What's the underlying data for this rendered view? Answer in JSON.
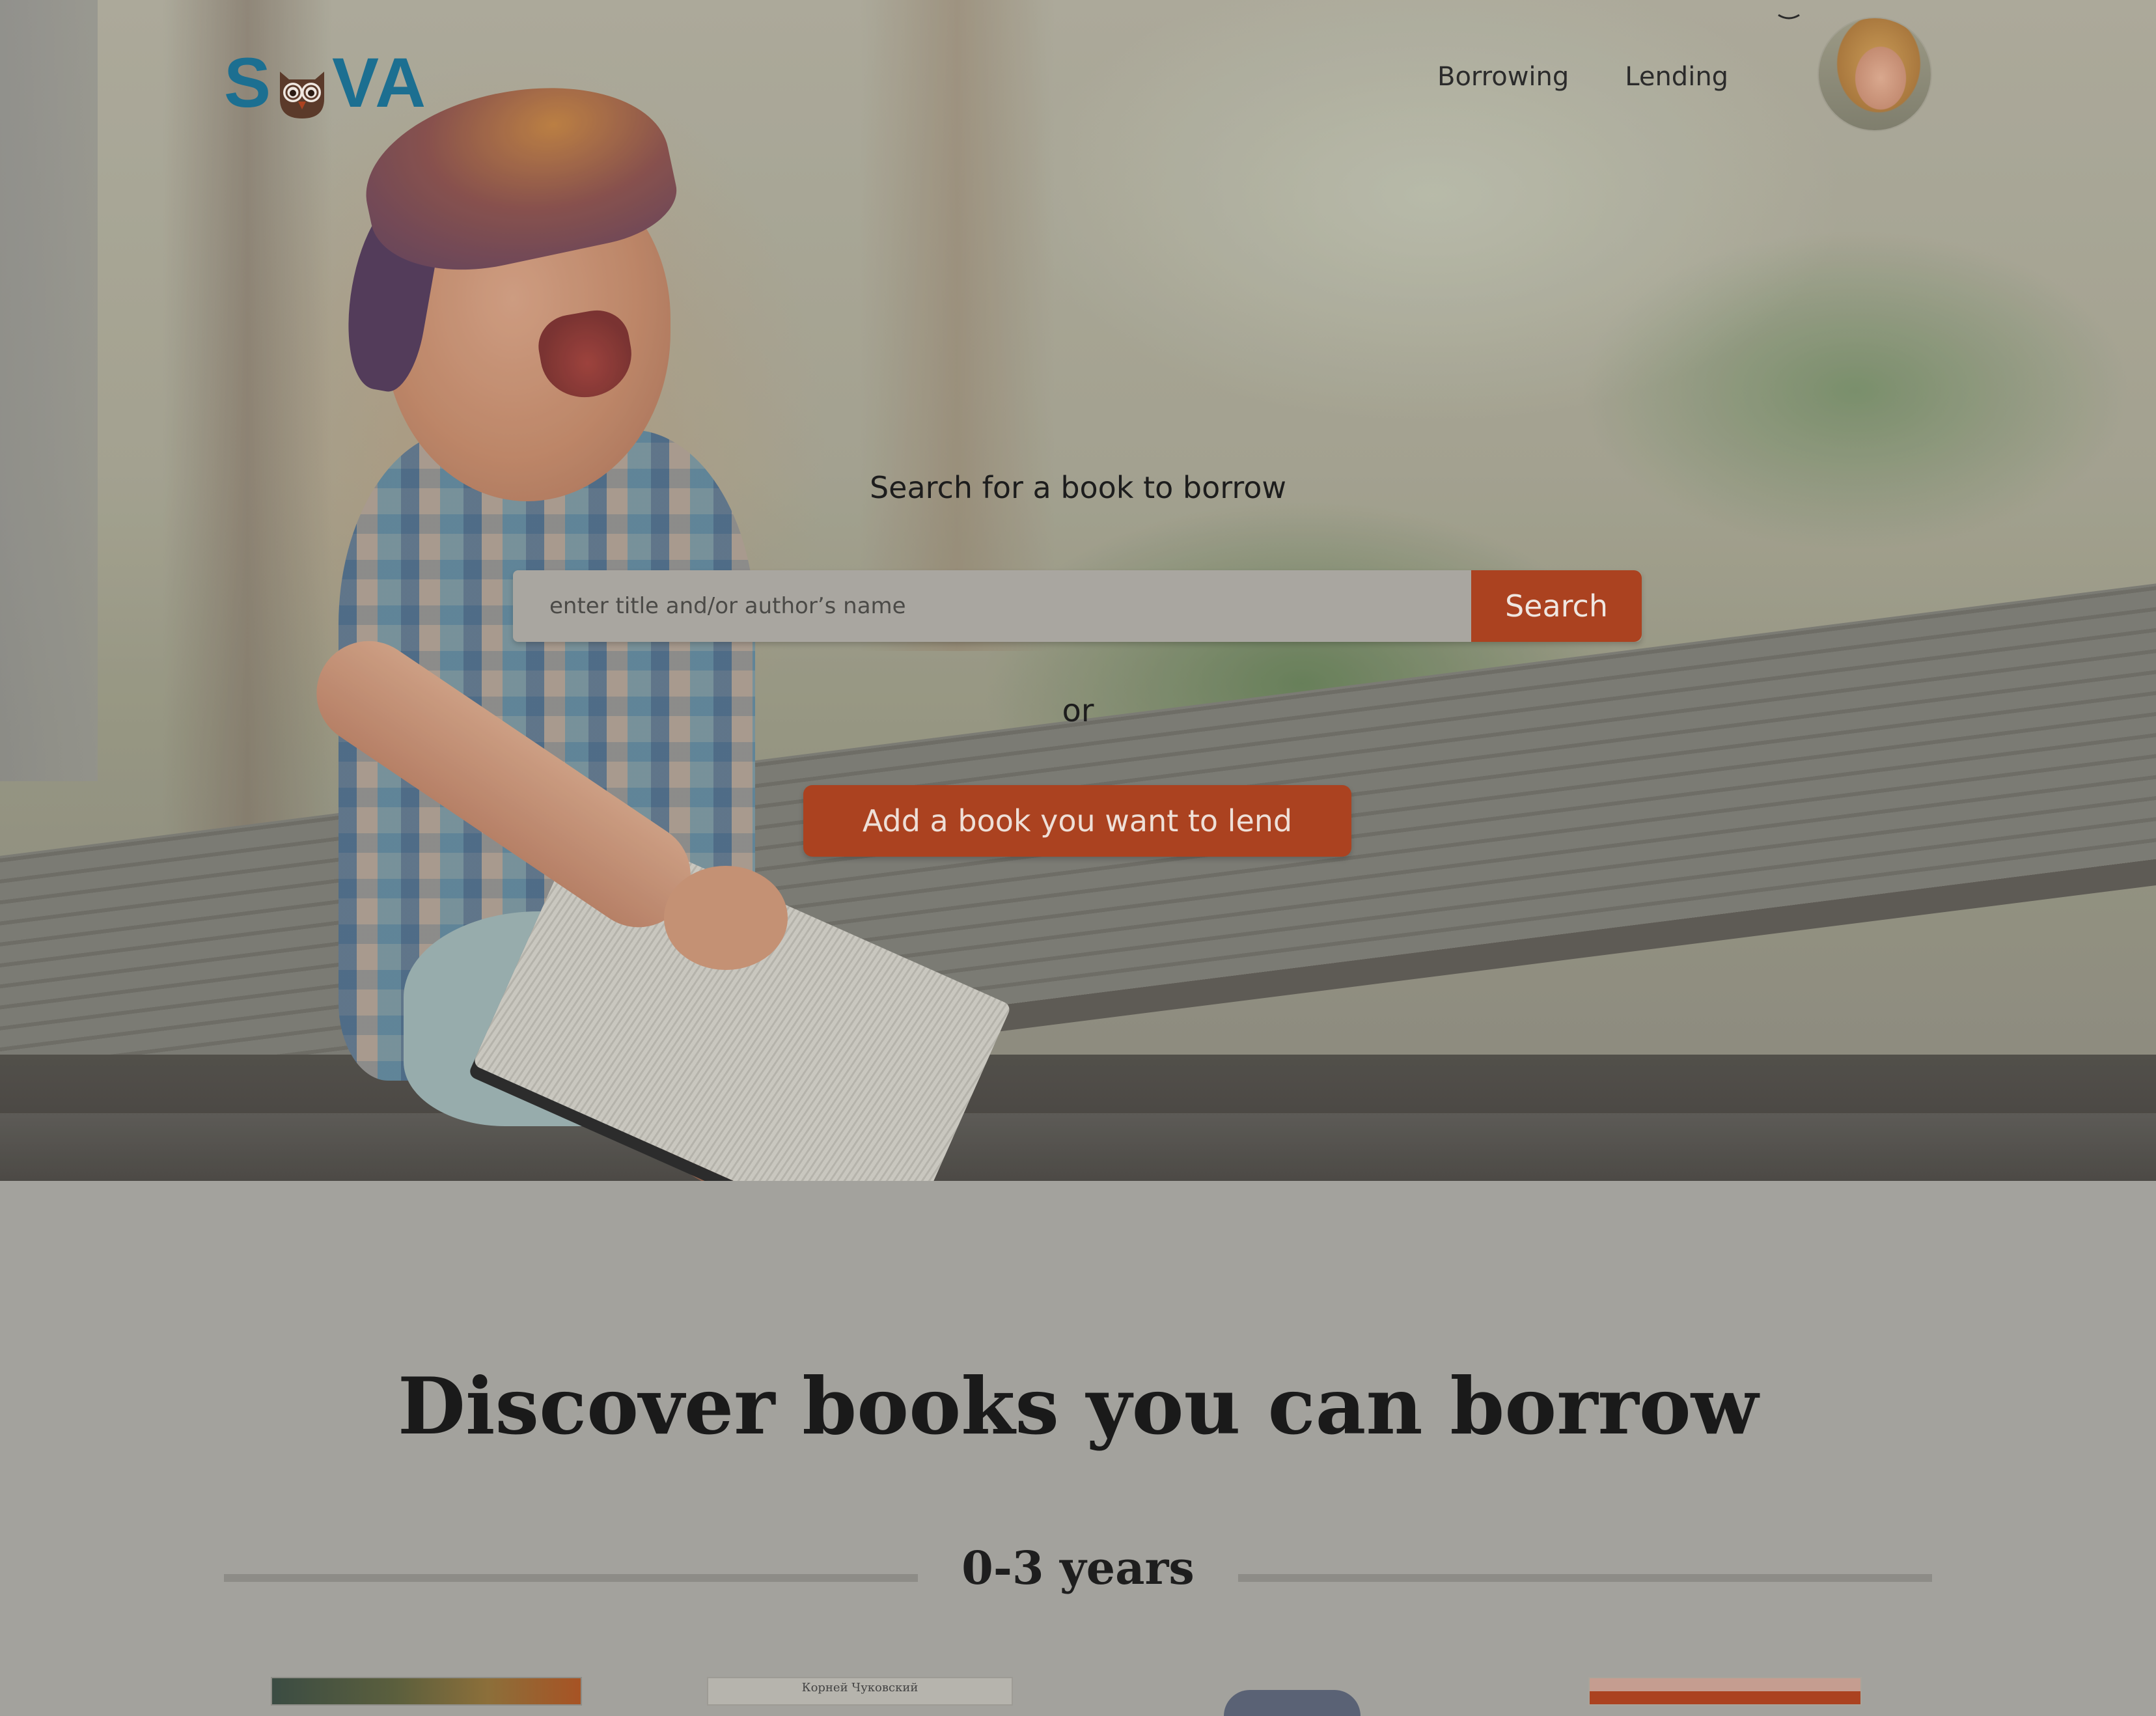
{
  "header": {
    "logo_text_left": "S",
    "logo_text_right": "VA",
    "nav": [
      {
        "label": "Borrowing"
      },
      {
        "label": "Lending"
      }
    ]
  },
  "hero": {
    "search_title": "Search for a book to borrow",
    "search_placeholder": "enter title and/or author’s name",
    "search_button": "Search",
    "or_text": "or",
    "lend_button": "Add a book you want to lend"
  },
  "discover": {
    "title": "Discover books you can borrow",
    "age_group": "0-3 years",
    "books": [
      {
        "visible_text": ""
      },
      {
        "visible_text": "Корней Чуковский"
      },
      {
        "visible_text": ""
      },
      {
        "visible_text": ""
      }
    ]
  },
  "colors": {
    "brand_blue": "#1c6f91",
    "accent_orange": "#ab4220",
    "owl_brown": "#5b3a2a"
  },
  "icons": {
    "logo_owl": "owl-icon",
    "avatar_caret": "chevron-down-icon"
  }
}
